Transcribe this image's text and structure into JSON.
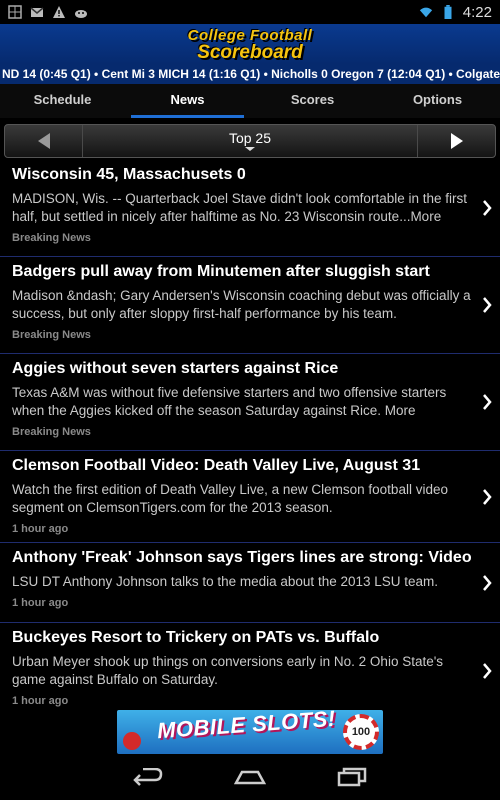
{
  "status": {
    "time": "4:22",
    "left_icons": [
      "grid-icon",
      "gmail-icon",
      "warning-icon",
      "android-icon"
    ],
    "right_icons": [
      "wifi-icon",
      "battery-icon"
    ]
  },
  "header": {
    "logo_line1": "College Football",
    "logo_line2": "Scoreboard"
  },
  "ticker": {
    "text": "ND 14 (0:45 Q1)  •  Cent Mi 3 MICH 14 (1:16 Q1)  •  Nicholls 0 Oregon 7 (12:04 Q1)  •  Colgate"
  },
  "tabs": [
    {
      "label": "Schedule",
      "active": false
    },
    {
      "label": "News",
      "active": true
    },
    {
      "label": "Scores",
      "active": false
    },
    {
      "label": "Options",
      "active": false
    }
  ],
  "navbar": {
    "title": "Top 25"
  },
  "news": [
    {
      "title": "Wisconsin 45, Massachusets 0",
      "desc": "MADISON, Wis. -- Quarterback Joel Stave didn't look comfortable in the first half, but settled in nicely after halftime as No. 23 Wisconsin route...More",
      "meta": "Breaking News"
    },
    {
      "title": "Badgers pull away from Minutemen after sluggish start",
      "desc": "Madison &ndash; Gary Andersen's Wisconsin coaching debut was officially a success, but only after sloppy first-half performance by his team.",
      "meta": "Breaking News"
    },
    {
      "title": "Aggies without seven starters against Rice",
      "desc": "Texas A&M was without five defensive starters and two offensive starters when the Aggies kicked off the season Saturday against Rice. More",
      "meta": "Breaking News"
    },
    {
      "title": "Clemson Football Video: Death Valley Live, August 31",
      "desc": "Watch the first edition of Death Valley Live, a new Clemson football video segment on ClemsonTigers.com for the 2013 season.",
      "meta": "1 hour ago"
    },
    {
      "title": "Anthony 'Freak' Johnson says Tigers lines are strong: Video",
      "desc": "LSU DT Anthony Johnson talks to the media about the 2013 LSU team.",
      "meta": "1 hour ago"
    },
    {
      "title": "Buckeyes Resort to Trickery on PATs vs. Buffalo",
      "desc": "Urban Meyer shook up things on conversions early in No. 2 Ohio State's game against Buffalo on Saturday.",
      "meta": "1 hour ago"
    }
  ],
  "ad": {
    "text": "MOBILE SLOTS!",
    "chip": "100"
  },
  "colors": {
    "header_blue": "#0a3a8f",
    "logo_gold": "#f6c40e",
    "tab_indicator": "#1f6fd6",
    "divider": "#1f2c6e"
  }
}
